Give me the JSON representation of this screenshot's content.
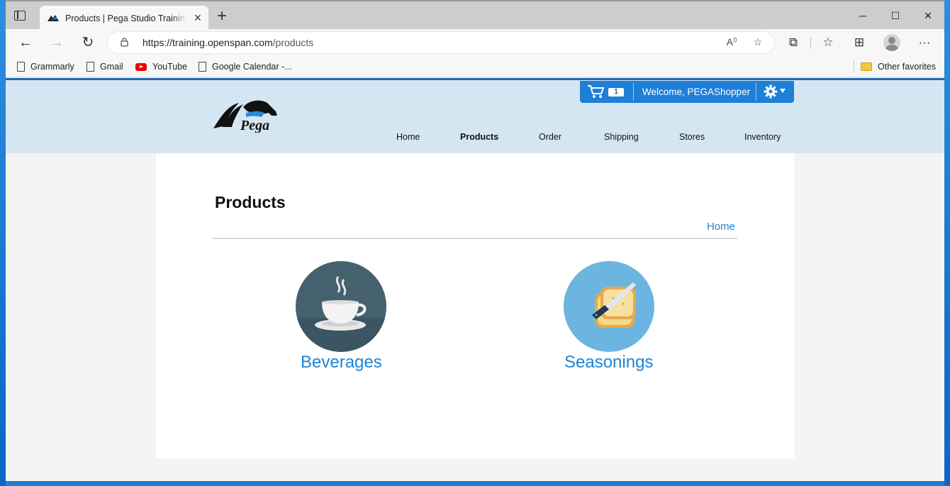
{
  "browser": {
    "tab_title": "Products | Pega Studio Training W",
    "url_host": "https://training.openspan.com",
    "url_path": "/products",
    "bookmarks": [
      "Grammarly",
      "Gmail",
      "YouTube",
      "Google Calendar -..."
    ],
    "other_favorites": "Other favorites"
  },
  "site": {
    "cart_count": "1",
    "welcome": "Welcome, PEGAShopper",
    "nav": [
      "Home",
      "Products",
      "Order",
      "Shipping",
      "Stores",
      "Inventory"
    ],
    "active_nav": "Products",
    "logo_text": "Pega",
    "brand_color": "#1e7fd8",
    "header_bg": "#d5e6f3"
  },
  "page": {
    "title": "Products",
    "breadcrumb": "Home",
    "categories": [
      {
        "label": "Beverages",
        "icon": "coffee-cup-icon",
        "bg": "#46616e"
      },
      {
        "label": "Seasonings",
        "icon": "bread-knife-icon",
        "bg": "#6cb5e0"
      }
    ]
  }
}
